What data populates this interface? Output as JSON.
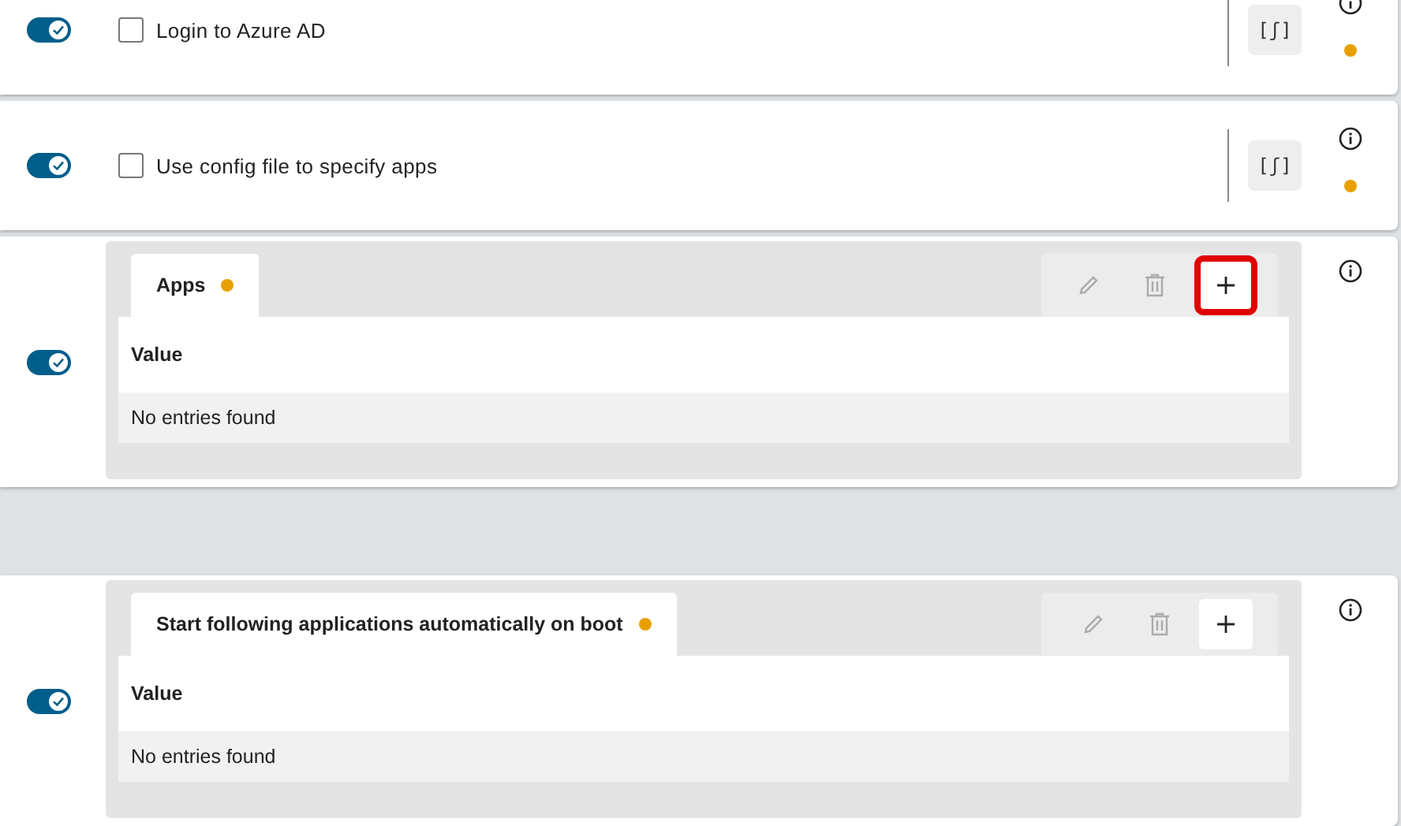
{
  "groups": [
    {
      "rows": [
        {
          "kind": "checkbox",
          "enabled": true,
          "label": "Login to Azure AD",
          "checked": false,
          "script_button": "[ʃ]",
          "modified": true
        },
        {
          "kind": "checkbox",
          "enabled": true,
          "label": "Use config file to specify apps",
          "checked": false,
          "script_button": "[ʃ]",
          "modified": true
        },
        {
          "kind": "table",
          "enabled": true,
          "tab": "Apps",
          "modified": true,
          "column": "Value",
          "empty_text": "No entries found",
          "add_highlighted": true
        }
      ]
    },
    {
      "rows": [
        {
          "kind": "table",
          "enabled": true,
          "tab": "Start following applications automatically on boot",
          "modified": true,
          "column": "Value",
          "empty_text": "No entries found",
          "add_highlighted": false
        }
      ]
    }
  ]
}
